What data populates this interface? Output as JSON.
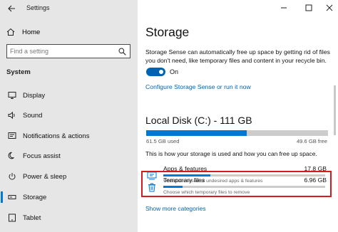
{
  "titlebar": {
    "title": "Settings",
    "minimize_icon": "minimize-icon",
    "maximize_icon": "maximize-icon",
    "close_icon": "close-icon"
  },
  "sidebar": {
    "home_label": "Home",
    "search_placeholder": "Find a setting",
    "section_label": "System",
    "items": [
      {
        "label": "Display",
        "icon": "display-icon"
      },
      {
        "label": "Sound",
        "icon": "sound-icon"
      },
      {
        "label": "Notifications & actions",
        "icon": "notifications-icon"
      },
      {
        "label": "Focus assist",
        "icon": "focus-assist-icon"
      },
      {
        "label": "Power & sleep",
        "icon": "power-icon"
      },
      {
        "label": "Storage",
        "icon": "storage-icon",
        "active": true
      },
      {
        "label": "Tablet",
        "icon": "tablet-icon"
      }
    ]
  },
  "main": {
    "title": "Storage",
    "description": "Storage Sense can automatically free up space by getting rid of files you don't need, like temporary files and content in your recycle bin.",
    "toggle_label": "On",
    "toggle_on": true,
    "configure_link": "Configure Storage Sense or run it now",
    "disk": {
      "title": "Local Disk (C:) - 111 GB",
      "used": "61.5 GB used",
      "free": "49.6 GB free",
      "used_fraction": 0.554
    },
    "howto": "This is how your storage is used and how you can free up space.",
    "categories": [
      {
        "name": "Apps & features",
        "size": "17.8 GB",
        "sub": "Uninstall unused or undesired apps & features",
        "fraction": 0.29
      },
      {
        "name": "Temporary files",
        "size": "6.96 GB",
        "sub": "Choose which temporary files to remove",
        "fraction": 0.12
      }
    ],
    "more_link": "Show more categories"
  },
  "colors": {
    "accent": "#0078d7",
    "highlight": "#d71920",
    "sidebar_bg": "#e6e6e6"
  }
}
